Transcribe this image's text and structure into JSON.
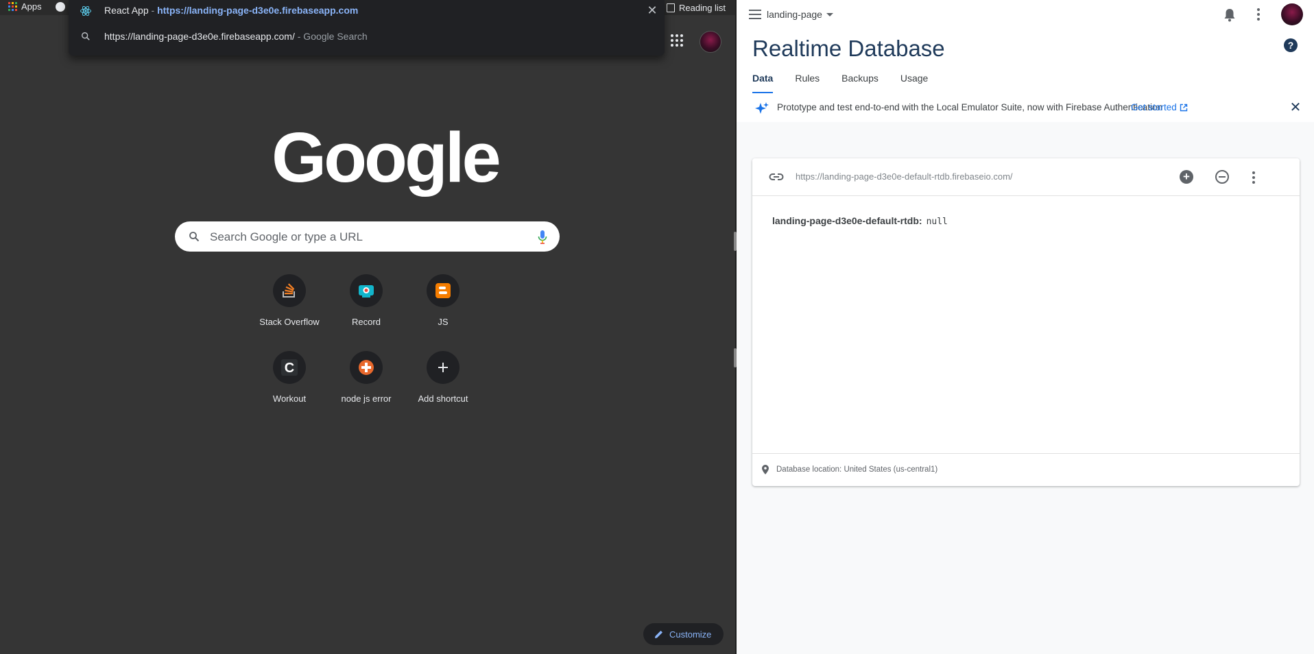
{
  "chrome": {
    "bookmarks": {
      "apps_label": "Apps",
      "reading_list_label": "Reading list"
    },
    "omnibox": {
      "tab_title": "React App",
      "separator": "-",
      "tab_url": "https://landing-page-d3e0e.firebaseapp.com",
      "suggestion_text": "https://landing-page-d3e0e.firebaseapp.com/",
      "suggestion_suffix": "- Google Search"
    },
    "logo_text": "Google",
    "search_placeholder": "Search Google or type a URL",
    "shortcuts": [
      {
        "label": "Stack Overflow",
        "icon": "stack-overflow-icon"
      },
      {
        "label": "Record",
        "icon": "record-icon"
      },
      {
        "label": "JS",
        "icon": "blogger-icon"
      },
      {
        "label": "Workout",
        "icon": "workout-c-icon"
      },
      {
        "label": "node js error",
        "icon": "node-error-icon"
      },
      {
        "label": "Add shortcut",
        "icon": "plus-icon"
      }
    ],
    "customize_label": "Customize",
    "colors": {
      "background": "#353535",
      "link_blue": "#8ab4f8"
    }
  },
  "firebase": {
    "project_name": "landing-page",
    "page_title": "Realtime Database",
    "help_glyph": "?",
    "tabs": [
      {
        "label": "Data",
        "active": true
      },
      {
        "label": "Rules",
        "active": false
      },
      {
        "label": "Backups",
        "active": false
      },
      {
        "label": "Usage",
        "active": false
      }
    ],
    "banner": {
      "text": "Prototype and test end-to-end with the Local Emulator Suite, now with Firebase Authentication",
      "link_label": "Get started"
    },
    "database": {
      "url": "https://landing-page-d3e0e-default-rtdb.firebaseio.com/",
      "root_key": "landing-page-d3e0e-default-rtdb",
      "root_value": "null",
      "location": "Database location: United States (us-central1)"
    },
    "colors": {
      "title": "#1f3a5a",
      "accent": "#1a73e8"
    }
  }
}
